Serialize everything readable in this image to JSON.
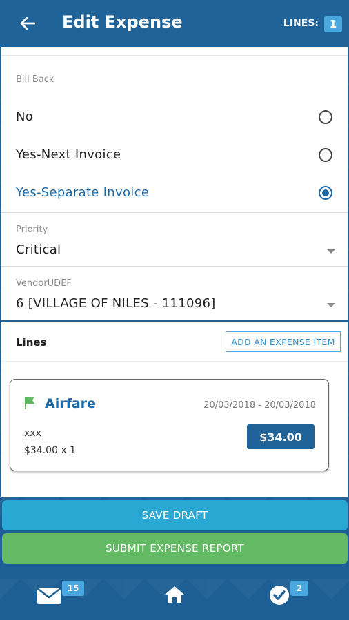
{
  "header": {
    "title": "Edit Expense",
    "lines_label": "LINES:",
    "lines_count": "1"
  },
  "bill_back": {
    "label": "Bill Back",
    "options": [
      {
        "label": "No",
        "selected": false
      },
      {
        "label": "Yes-Next Invoice",
        "selected": false
      },
      {
        "label": "Yes-Separate Invoice",
        "selected": true
      }
    ]
  },
  "priority": {
    "label": "Priority",
    "value": "Critical"
  },
  "vendor": {
    "label": "VendorUDEF",
    "value": "6 [VILLAGE OF NILES - 111096]"
  },
  "lines": {
    "title": "Lines",
    "add_button": "ADD AN EXPENSE ITEM",
    "items": [
      {
        "category": "Airfare",
        "dates": "20/03/2018 - 20/03/2018",
        "description": "xxx",
        "quantity": "$34.00 x 1",
        "amount": "$34.00"
      }
    ]
  },
  "actions": {
    "save_draft": "SAVE DRAFT",
    "submit": "SUBMIT EXPENSE REPORT"
  },
  "nav": {
    "messages_badge": "15",
    "approvals_badge": "2"
  },
  "colors": {
    "primary": "#1f6399",
    "accent": "#4aa8e0",
    "save": "#2aa8d4",
    "submit": "#63b964",
    "flag": "#5cb85c"
  }
}
